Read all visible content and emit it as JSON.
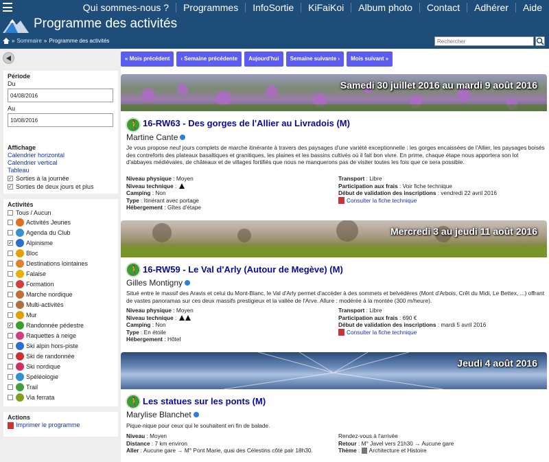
{
  "nav": [
    "Qui sommes-nous ?",
    "Programmes",
    "InfoSortie",
    "KiFaiKoi",
    "Album photo",
    "Contact",
    "Adhérer",
    "Aide"
  ],
  "header": {
    "title": "Programme des activités"
  },
  "breadcrumb": {
    "home": "Sommaire",
    "sep": "»",
    "current": "Programme des activités"
  },
  "search": {
    "placeholder": "Rechercher"
  },
  "colors": {
    "bar": "#1f4d7a",
    "button": "#5c5cf0",
    "title": "#0a0a9a"
  },
  "sidebar": {
    "periode": {
      "title": "Période",
      "from_label": "Du",
      "from": "04/08/2016",
      "to_label": "Au",
      "to": "10/08/2016"
    },
    "affichage": {
      "title": "Affichage",
      "links": [
        "Calendrier horizontal",
        "Calendrier vertical",
        "Tableau"
      ],
      "checks": [
        {
          "label": "Sorties à la journée",
          "checked": true
        },
        {
          "label": "Sorties de deux jours et plus",
          "checked": true
        }
      ]
    },
    "activites": {
      "title": "Activités",
      "all": "Tous / Aucun",
      "items": [
        {
          "label": "Activités Jeunes",
          "checked": false,
          "color": "#e07020"
        },
        {
          "label": "Agenda du Club",
          "checked": false,
          "color": "#3a8fd0"
        },
        {
          "label": "Alpinisme",
          "checked": true,
          "color": "#2a6fd0"
        },
        {
          "label": "Bloc",
          "checked": false,
          "color": "#e8a000"
        },
        {
          "label": "Destinations lointaines",
          "checked": false,
          "color": "#e08030"
        },
        {
          "label": "Falaise",
          "checked": false,
          "color": "#e8b000"
        },
        {
          "label": "Formation",
          "checked": false,
          "color": "#d04040"
        },
        {
          "label": "Marche nordique",
          "checked": false,
          "color": "#c07030"
        },
        {
          "label": "Multi-activités",
          "checked": false,
          "color": "#b07040"
        },
        {
          "label": "Mur",
          "checked": false,
          "color": "#e0a000"
        },
        {
          "label": "Randonnée pédestre",
          "checked": true,
          "color": "#3a9f2a"
        },
        {
          "label": "Raquettes à neige",
          "checked": false,
          "color": "#d04080"
        },
        {
          "label": "Ski alpin hors-piste",
          "checked": false,
          "color": "#2a70d0"
        },
        {
          "label": "Ski de randonnée",
          "checked": false,
          "color": "#d03030"
        },
        {
          "label": "Ski nordique",
          "checked": false,
          "color": "#d03060"
        },
        {
          "label": "Spéléologie",
          "checked": false,
          "color": "#3090d0"
        },
        {
          "label": "Trail",
          "checked": false,
          "color": "#40a040"
        },
        {
          "label": "Via ferrata",
          "checked": false,
          "color": "#80a020"
        }
      ]
    },
    "actions": {
      "title": "Actions",
      "print": "Imprimer le programme"
    }
  },
  "buttons": [
    "« Mois précédent",
    "‹ Semaine précédente",
    "Aujourd'hui",
    "Semaine suivante ›",
    "Mois suivant »"
  ],
  "events": [
    {
      "date": "Samedi 30 juillet 2016 au mardi 9 août 2016",
      "title": "16-RW63 - Des gorges de l'Allier au Livradois (M)",
      "leader": "Martine Cante",
      "desc": "Je vous propose neuf jours complets de marche itinérante à travers des paysages d'une variété exceptionnelle : les gorges encaissées de l'Allier, les paysages boisés des contreforts des plateaux basaltiques et granitiques, les plaines et les bassins cultivés où il fait bon vivre. En prime, chaque étape nous apportera son lot d'abbayes médiévales, de châteaux et de villages fortifiés que nous ne manquerons pas de visiter toutes les fois que ce sera possible.",
      "left": [
        [
          "Niveau physique",
          "Moyen"
        ],
        [
          "Niveau technique",
          ""
        ],
        [
          "Camping",
          "Non"
        ],
        [
          "Type",
          "Itinérant avec portage"
        ],
        [
          "Hébergement",
          "Gîtes d'étape"
        ]
      ],
      "right": [
        [
          "Transport",
          "Libre"
        ],
        [
          "Participation aux frais",
          "Voir fiche technique"
        ],
        [
          "Début de validation des inscriptions",
          "vendredi 22 avril 2016"
        ]
      ],
      "link": "Consulter la fiche technique"
    },
    {
      "date": "Mercredi 3 au jeudi 11 août 2016",
      "title": "16-RW59 - Le Val d'Arly (Autour de Megève) (M)",
      "leader": "Gilles Montigny",
      "desc": "Situé entre le massif des Aravis et celui du Mont-Blanc, le Val d'Arly permet d'accéder à des sommets et belvédères (Mont d'Arbois, Crêt du Midi, Le Bettex, ...) offrant de vastes panoramas sur ces deux massifs prestigieux et la vallée de l'Arve. Allure : modérée à la montée (300 m/heure).",
      "left": [
        [
          "Niveau physique",
          "Moyen"
        ],
        [
          "Niveau technique",
          ""
        ],
        [
          "Camping",
          "Non"
        ],
        [
          "Type",
          "En étoile"
        ],
        [
          "Hébergement",
          "Hôtel"
        ]
      ],
      "right": [
        [
          "Transport",
          "Libre"
        ],
        [
          "Participation aux frais",
          "690 €"
        ],
        [
          "Début de validation des inscriptions",
          "mardi 5 avril 2016"
        ]
      ],
      "link": "Consulter la fiche technique"
    },
    {
      "date": "Jeudi 4 août 2016",
      "title": "Les statues sur les ponts (M)",
      "leader": "Marylise Blanchet",
      "desc": "Pique-nique pour ceux qui le souhaitent en fin de balade.",
      "left": [
        [
          "Niveau",
          "Moyen"
        ],
        [
          "Distance",
          "7 km environ"
        ],
        [
          "Aller",
          "Aucune gare → M° Pont Marie, quai des Célestins côté pair 18h30."
        ]
      ],
      "right": [
        [
          "",
          "Rendez-vous à l'arrivée"
        ],
        [
          "Retour",
          "M° Javel vers 21h30 → Aucune gare"
        ],
        [
          "Thème",
          "Architecture et Histoire"
        ]
      ]
    }
  ]
}
